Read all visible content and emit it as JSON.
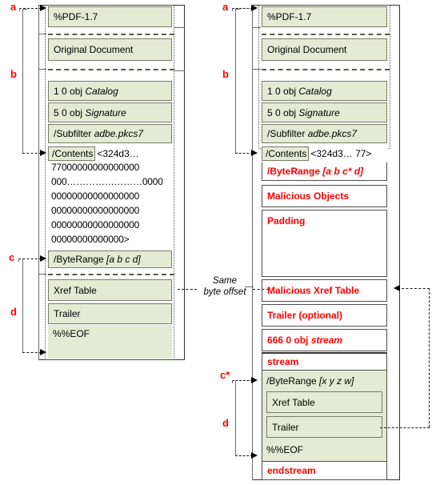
{
  "figure": {
    "title": "PDF incremental-update signature wrapping attack",
    "colors": {
      "green_fill": "#e4ead3",
      "red_text": "#ff0000",
      "border": "#4d4d4d"
    },
    "annotation": {
      "same_byte_offset": "Same\nbyte offset",
      "same_byte_offset_line1": "Same",
      "same_byte_offset_line2": "byte offset"
    }
  },
  "left": {
    "brackets": [
      {
        "id": "a",
        "label": "a"
      },
      {
        "id": "b",
        "label": "b"
      },
      {
        "id": "c",
        "label": "c"
      },
      {
        "id": "d",
        "label": "d"
      }
    ],
    "rows": [
      {
        "label": "%PDF-1.7",
        "style": "green"
      },
      {
        "label": "Original Document",
        "style": "green"
      },
      {
        "label": "1 0 obj ",
        "em": "Catalog",
        "style": "green"
      },
      {
        "label": "5 0 obj ",
        "em": "Signature",
        "style": "green"
      },
      {
        "label": "/Subfilter ",
        "em": "adbe.pkcs7",
        "style": "green"
      },
      {
        "label": "/Contents ",
        "tail": "<324d3…",
        "style": "green-white"
      }
    ],
    "hex_lines": [
      "77000000000000000",
      "000……………………0000",
      "00000000000000000",
      "00000000000000000",
      "00000000000000000",
      "00000000000000>"
    ],
    "byterange": {
      "label": "/ByteRange ",
      "em": "[a b c d]"
    },
    "tail_rows": [
      {
        "label": "Xref Table",
        "style": "green"
      },
      {
        "label": "Trailer",
        "style": "green"
      },
      {
        "label": "%%EOF",
        "style": "green-plain"
      }
    ]
  },
  "right": {
    "brackets": [
      {
        "id": "a",
        "label": "a"
      },
      {
        "id": "b",
        "label": "b"
      },
      {
        "id": "c*",
        "label": "c*"
      },
      {
        "id": "d",
        "label": "d"
      }
    ],
    "rows": [
      {
        "label": "%PDF-1.7",
        "style": "green",
        "color": "black"
      },
      {
        "label": "Original Document",
        "style": "green",
        "color": "black"
      },
      {
        "label": "1 0 obj ",
        "em": "Catalog",
        "style": "green",
        "color": "black"
      },
      {
        "label": "5 0 obj ",
        "em": "Signature",
        "style": "green",
        "color": "black"
      },
      {
        "label": "/Subfilter ",
        "em": "adbe.pkcs7",
        "style": "green",
        "color": "black"
      },
      {
        "label": "/Contents ",
        "tail": "<324d3… 77>",
        "style": "green-white",
        "color": "black"
      },
      {
        "label": "/ByteRange ",
        "em": "[a b c* d]",
        "style": "white",
        "color": "red"
      },
      {
        "label": "Malicious Objects",
        "style": "white",
        "color": "red"
      },
      {
        "label": "Padding",
        "style": "white",
        "color": "red"
      },
      {
        "label": "Malicious Xref Table",
        "style": "white",
        "color": "red"
      },
      {
        "label": "Trailer (optional)",
        "style": "white",
        "color": "red"
      },
      {
        "label": "666 0 obj ",
        "em": "stream",
        "style": "white",
        "color": "red"
      },
      {
        "label": "stream",
        "style": "white",
        "color": "red"
      },
      {
        "label": "/ByteRange ",
        "em": "[x y z w]",
        "style": "green-plain",
        "color": "black"
      },
      {
        "label": "Xref Table",
        "style": "green-inner",
        "color": "black"
      },
      {
        "label": "Trailer",
        "style": "green-inner",
        "color": "black"
      },
      {
        "label": "%%EOF",
        "style": "green-plain",
        "color": "black"
      },
      {
        "label": "endstream",
        "style": "white",
        "color": "red"
      }
    ]
  }
}
